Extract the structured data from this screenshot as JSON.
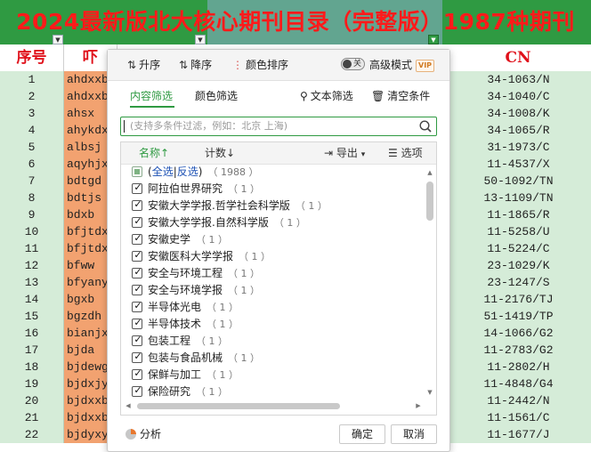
{
  "sheet": {
    "title": "2024最新版北大核心期刊目录（完整版）1987种期刊",
    "headers": {
      "seq": "序号",
      "abbr": "吓",
      "cn": "CN"
    },
    "rows": [
      {
        "seq": "1",
        "abbr": "ahdxxb",
        "cn": "34-1063/N"
      },
      {
        "seq": "2",
        "abbr": "ahdxxb",
        "cn": "34-1040/C"
      },
      {
        "seq": "3",
        "abbr": "ahsx",
        "cn": "34-1008/K"
      },
      {
        "seq": "4",
        "abbr": "ahykdx",
        "cn": "34-1065/R"
      },
      {
        "seq": "5",
        "abbr": "albsj",
        "cn": "31-1973/C"
      },
      {
        "seq": "6",
        "abbr": "aqyhjx",
        "cn": "11-4537/X"
      },
      {
        "seq": "7",
        "abbr": "bdtgd",
        "cn": "50-1092/TN"
      },
      {
        "seq": "8",
        "abbr": "bdtjs",
        "cn": "13-1109/TN"
      },
      {
        "seq": "9",
        "abbr": "bdxb",
        "cn": "11-1865/R"
      },
      {
        "seq": "10",
        "abbr": "bfjtdx",
        "cn": "11-5258/U"
      },
      {
        "seq": "11",
        "abbr": "bfjtdx",
        "cn": "11-5224/C"
      },
      {
        "seq": "12",
        "abbr": "bfww",
        "cn": "23-1029/K"
      },
      {
        "seq": "13",
        "abbr": "bfyany",
        "cn": "23-1247/S"
      },
      {
        "seq": "14",
        "abbr": "bgxb",
        "cn": "11-2176/TJ"
      },
      {
        "seq": "15",
        "abbr": "bgzdh",
        "cn": "51-1419/TP"
      },
      {
        "seq": "16",
        "abbr": "bianjx",
        "cn": "14-1066/G2"
      },
      {
        "seq": "17",
        "abbr": "bjda",
        "cn": "11-2783/G2"
      },
      {
        "seq": "18",
        "abbr": "bjdewg",
        "cn": "11-2802/H"
      },
      {
        "seq": "19",
        "abbr": "bjdxjy",
        "cn": "11-4848/G4"
      },
      {
        "seq": "20",
        "abbr": "bjdxxb",
        "cn": "11-2442/N"
      },
      {
        "seq": "21",
        "abbr": "bjdxxb",
        "cn": "11-1561/C"
      },
      {
        "seq": "22",
        "abbr": "bjdyxy",
        "cn": "11-1677/J"
      }
    ]
  },
  "dialog": {
    "toolbar": {
      "asc": "升序",
      "desc": "降序",
      "color_sort": "颜色排序",
      "toggle_state": "关",
      "advanced": "高级模式",
      "vip": "VIP"
    },
    "tabs": {
      "content": "内容筛选",
      "color": "颜色筛选",
      "text_filter": "文本筛选",
      "clear": "清空条件"
    },
    "search": {
      "placeholder": "(支持多条件过滤，例如：北京 上海)"
    },
    "list_head": {
      "name": "名称↑",
      "count": "计数↓",
      "export": "导出",
      "options": "选项"
    },
    "select_all": {
      "open": "(",
      "all": "全选",
      "sep": "|",
      "invert": "反选",
      "close": ")",
      "count": "（ 1988 ）"
    },
    "items": [
      {
        "label": "阿拉伯世界研究",
        "count": "（ 1 ）"
      },
      {
        "label": "安徽大学学报.哲学社会科学版",
        "count": "（ 1 ）"
      },
      {
        "label": "安徽大学学报.自然科学版",
        "count": "（ 1 ）"
      },
      {
        "label": "安徽史学",
        "count": "（ 1 ）"
      },
      {
        "label": "安徽医科大学学报",
        "count": "（ 1 ）"
      },
      {
        "label": "安全与环境工程",
        "count": "（ 1 ）"
      },
      {
        "label": "安全与环境学报",
        "count": "（ 1 ）"
      },
      {
        "label": "半导体光电",
        "count": "（ 1 ）"
      },
      {
        "label": "半导体技术",
        "count": "（ 1 ）"
      },
      {
        "label": "包装工程",
        "count": "（ 1 ）"
      },
      {
        "label": "包装与食品机械",
        "count": "（ 1 ）"
      },
      {
        "label": "保鲜与加工",
        "count": "（ 1 ）"
      },
      {
        "label": "保险研究",
        "count": "（ 1 ）"
      }
    ],
    "footer": {
      "analysis": "分析",
      "ok": "确定",
      "cancel": "取消"
    }
  },
  "colors": {
    "accent": "#2f9a42",
    "title_red": "#ff1a1a",
    "seq_bg": "#d5ecd8",
    "abbr_bg": "#f2a270"
  }
}
